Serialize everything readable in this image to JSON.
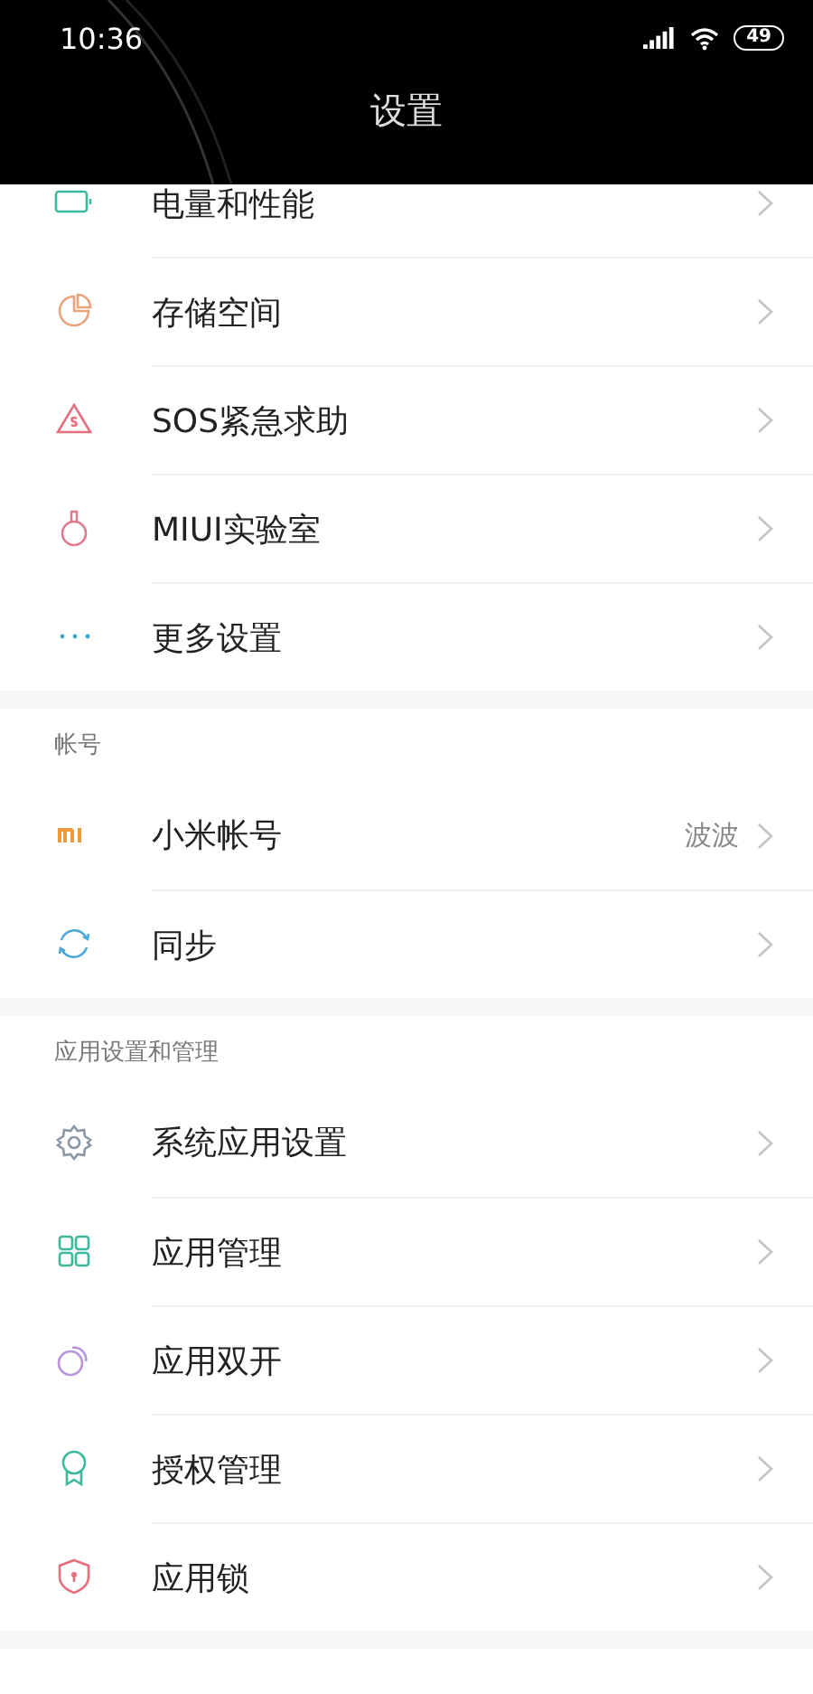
{
  "status_bar": {
    "time": "10:36",
    "battery": "49"
  },
  "header": {
    "title": "设置"
  },
  "sections": [
    {
      "items": [
        {
          "kind": "battery",
          "label": "电量和性能"
        },
        {
          "kind": "storage",
          "label": "存储空间"
        },
        {
          "kind": "sos",
          "label": "SOS紧急求助"
        },
        {
          "kind": "lab",
          "label": "MIUI实验室"
        },
        {
          "kind": "more",
          "label": "更多设置"
        }
      ]
    },
    {
      "title": "帐号",
      "items": [
        {
          "kind": "mi",
          "label": "小米帐号",
          "value": "波波"
        },
        {
          "kind": "sync",
          "label": "同步"
        }
      ]
    },
    {
      "title": "应用设置和管理",
      "items": [
        {
          "kind": "gear",
          "label": "系统应用设置"
        },
        {
          "kind": "grid",
          "label": "应用管理"
        },
        {
          "kind": "dual",
          "label": "应用双开"
        },
        {
          "kind": "badge",
          "label": "授权管理"
        },
        {
          "kind": "lock",
          "label": "应用锁"
        }
      ]
    }
  ]
}
